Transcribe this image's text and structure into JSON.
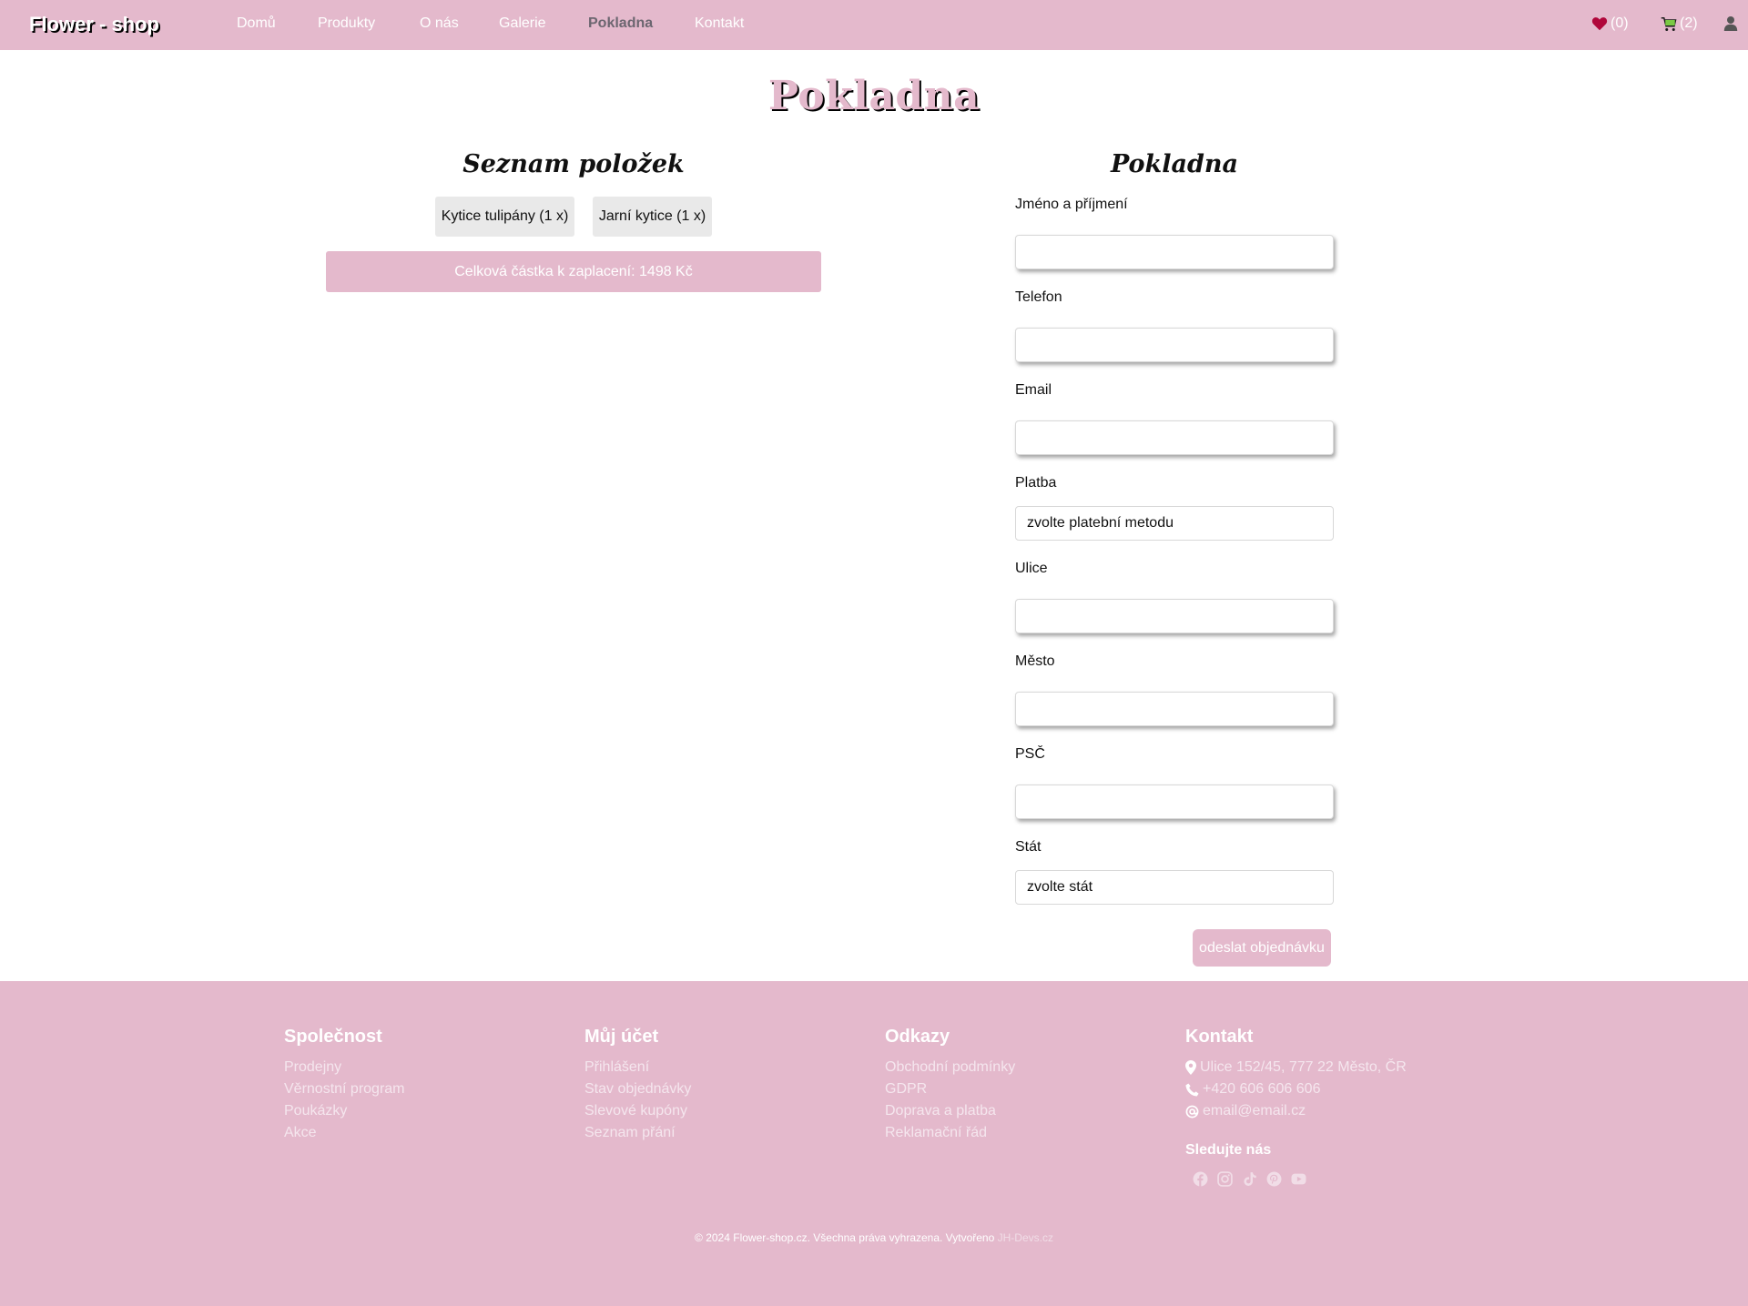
{
  "navbar": {
    "brand": "Flower - shop",
    "links": [
      "Domů",
      "Produkty",
      "O nás",
      "Galerie",
      "Pokladna",
      "Kontakt"
    ],
    "active_link": "Pokladna",
    "wishlist_count": "(0)",
    "cart_count": "(2)",
    "icons": {
      "wishlist": "heart-icon",
      "cart": "cart-icon",
      "account": "user-icon"
    },
    "colors": {
      "background": "#e4b9cc",
      "heart": "#b0063a",
      "cart": "#7ac943"
    }
  },
  "page": {
    "title": "Pokladna"
  },
  "items_section": {
    "heading": "Seznam položek",
    "items": [
      "Kytice tulipány (1 x)",
      "Jarní kytice (1 x)"
    ],
    "total": "Celková částka k zaplacení: 1498 Kč"
  },
  "checkout_form": {
    "heading": "Pokladna",
    "fields": [
      {
        "label": "Jméno a příjmení",
        "value": "",
        "type": "input"
      },
      {
        "label": "Telefon",
        "value": "",
        "type": "input"
      },
      {
        "label": "Email",
        "value": "",
        "type": "input"
      },
      {
        "label": "Platba",
        "value": "zvolte platební metodu",
        "type": "select"
      },
      {
        "label": "Ulice",
        "value": "",
        "type": "input"
      },
      {
        "label": "Město",
        "value": "",
        "type": "input"
      },
      {
        "label": "PSČ",
        "value": "",
        "type": "input"
      },
      {
        "label": "Stát",
        "value": "zvolte stát",
        "type": "select"
      }
    ],
    "submit_label": "odeslat objednávku"
  },
  "footer": {
    "columns": [
      {
        "title": "Společnost",
        "links": [
          "Prodejny",
          "Věrnostní program",
          "Poukázky",
          "Akce"
        ]
      },
      {
        "title": "Můj účet",
        "links": [
          "Přihlášení",
          "Stav objednávky",
          "Slevové kupóny",
          "Seznam přání"
        ]
      },
      {
        "title": "Odkazy",
        "links": [
          "Obchodní podmínky",
          "GDPR",
          "Doprava a platba",
          "Reklamační řád"
        ]
      }
    ],
    "contact": {
      "title": "Kontakt",
      "address": "Ulice 152/45, 777 22 Město, ČR",
      "phone": "+420 606 606 606",
      "email": "email@email.cz",
      "follow_title": "Sledujte nás",
      "social_icons": [
        "facebook-icon",
        "instagram-icon",
        "tiktok-icon",
        "pinterest-icon",
        "youtube-icon"
      ]
    },
    "copyright": "© 2024 Flower-shop.cz. Všechna práva vyhrazena. Vytvořeno",
    "credit": "JH-Devs.cz"
  }
}
